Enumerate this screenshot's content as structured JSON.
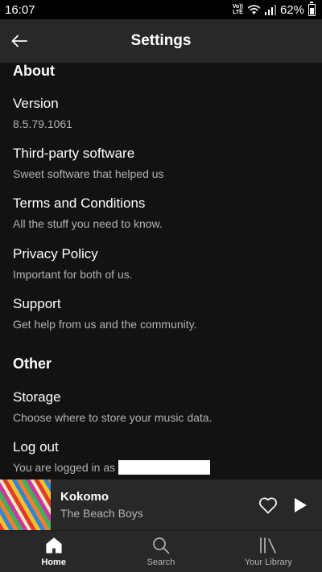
{
  "status_bar": {
    "time": "16:07",
    "network": "Vo)) LTE",
    "battery": "62%"
  },
  "header": {
    "title": "Settings"
  },
  "sections": {
    "about": {
      "title": "About",
      "items": [
        {
          "title": "Version",
          "subtitle": "8.5.79.1061"
        },
        {
          "title": "Third-party software",
          "subtitle": "Sweet software that helped us"
        },
        {
          "title": "Terms and Conditions",
          "subtitle": "All the stuff you need to know."
        },
        {
          "title": "Privacy Policy",
          "subtitle": "Important for both of us."
        },
        {
          "title": "Support",
          "subtitle": "Get help from us and the community."
        }
      ]
    },
    "other": {
      "title": "Other",
      "items": [
        {
          "title": "Storage",
          "subtitle": "Choose where to store your music data."
        },
        {
          "title": "Log out",
          "subtitle": "You are logged in as"
        }
      ]
    }
  },
  "player": {
    "track": "Kokomo",
    "artist": "The Beach Boys"
  },
  "nav": {
    "tabs": [
      {
        "label": "Home",
        "icon": "home-icon",
        "active": true
      },
      {
        "label": "Search",
        "icon": "search-icon",
        "active": false
      },
      {
        "label": "Your Library",
        "icon": "library-icon",
        "active": false
      }
    ]
  }
}
